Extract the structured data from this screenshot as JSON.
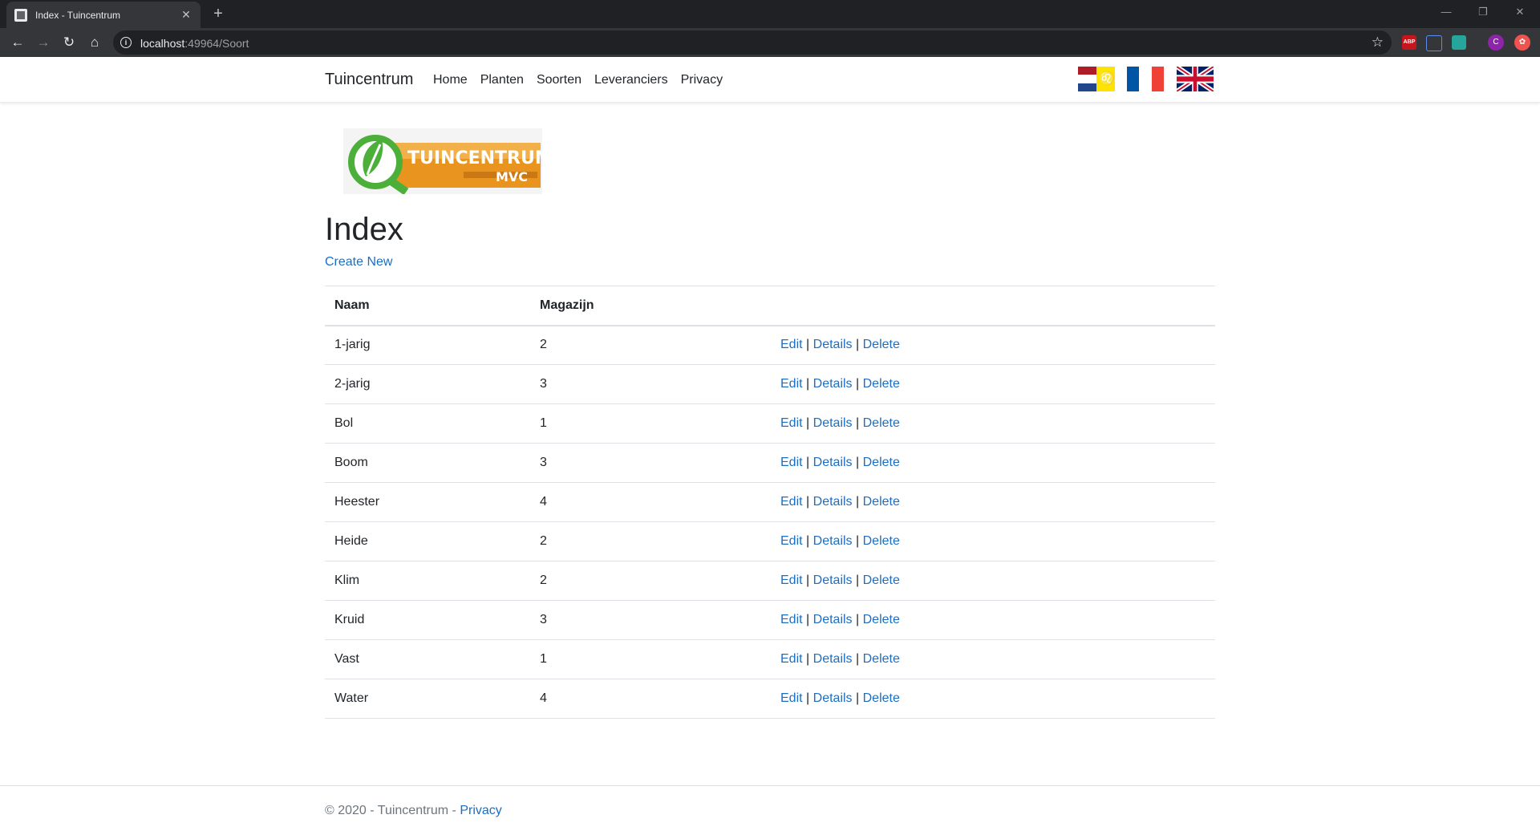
{
  "browser": {
    "tab_title": "Index - Tuincentrum",
    "url_host": "localhost",
    "url_rest": ":49964/Soort",
    "extensions": [
      "ABP"
    ],
    "profile_initial": "C"
  },
  "navbar": {
    "brand": "Tuincentrum",
    "links": [
      "Home",
      "Planten",
      "Soorten",
      "Leveranciers",
      "Privacy"
    ]
  },
  "logo": {
    "line1": "TUINCENTRUM",
    "line2": "MVC"
  },
  "page": {
    "title": "Index",
    "create_link": "Create New"
  },
  "table": {
    "headers": [
      "Naam",
      "Magazijn",
      ""
    ],
    "action_labels": {
      "edit": "Edit",
      "details": "Details",
      "delete": "Delete",
      "separator": "|"
    },
    "rows": [
      {
        "naam": "1-jarig",
        "magazijn": "2"
      },
      {
        "naam": "2-jarig",
        "magazijn": "3"
      },
      {
        "naam": "Bol",
        "magazijn": "1"
      },
      {
        "naam": "Boom",
        "magazijn": "3"
      },
      {
        "naam": "Heester",
        "magazijn": "4"
      },
      {
        "naam": "Heide",
        "magazijn": "2"
      },
      {
        "naam": "Klim",
        "magazijn": "2"
      },
      {
        "naam": "Kruid",
        "magazijn": "3"
      },
      {
        "naam": "Vast",
        "magazijn": "1"
      },
      {
        "naam": "Water",
        "magazijn": "4"
      }
    ]
  },
  "footer": {
    "text": "© 2020 - Tuincentrum - ",
    "link": "Privacy"
  },
  "colors": {
    "link": "#1b6ec2",
    "logo_orange": "#e8941f",
    "logo_green": "#4caf3a"
  }
}
